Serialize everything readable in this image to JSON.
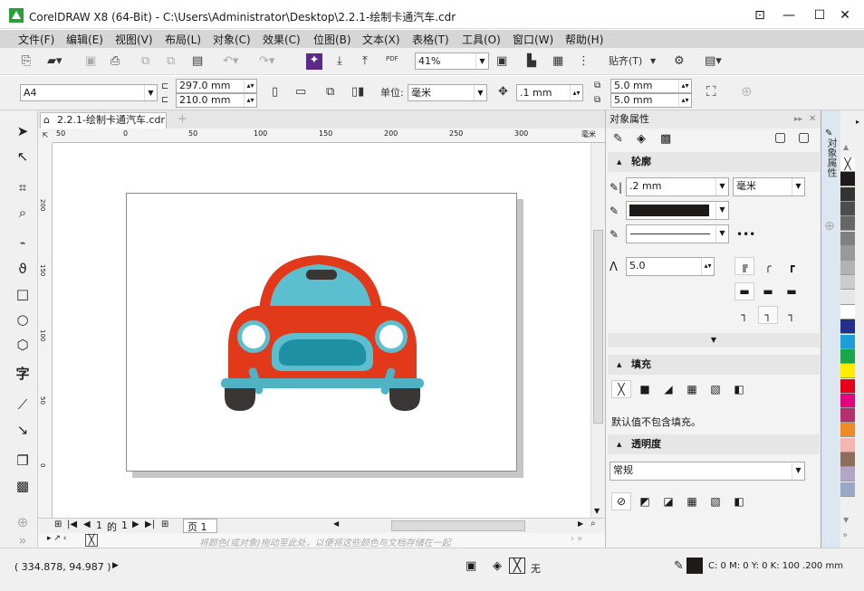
{
  "title": "CorelDRAW X8 (64-Bit) - C:\\Users\\Administrator\\Desktop\\2.2.1-绘制卡通汽车.cdr",
  "menus": [
    "文件(F)",
    "编辑(E)",
    "视图(V)",
    "布局(L)",
    "对象(C)",
    "效果(C)",
    "位图(B)",
    "文本(X)",
    "表格(T)",
    "工具(O)",
    "窗口(W)",
    "帮助(H)"
  ],
  "toolbar": {
    "zoom": "41%",
    "snap": "贴齐(T)",
    "pdf": "PDF"
  },
  "property_bar": {
    "paper": "A4",
    "width": "297.0 mm",
    "height": "210.0 mm",
    "unit_label": "单位:",
    "unit": "毫米",
    "nudge": ".1 mm",
    "dup_x": "5.0 mm",
    "dup_y": "5.0 mm"
  },
  "doc_tab": "2.2.1-绘制卡通汽车.cdr",
  "ruler": {
    "h": [
      "50",
      "0",
      "50",
      "100",
      "150",
      "200",
      "250",
      "300"
    ],
    "unit": "毫米",
    "v": [
      "200",
      "150",
      "100",
      "50",
      "0"
    ]
  },
  "page_nav": {
    "page": "1",
    "of": "的",
    "total": "1",
    "tab": "页 1"
  },
  "palette_hint": "将颜色(或对象)拖动至此处，以便将这些颜色与文档存储在一起",
  "status": {
    "coords": "( 334.878, 94.987 )",
    "fill_none": "无",
    "outline_info": "C: 0 M: 0 Y: 0 K: 100  .200 mm"
  },
  "panel": {
    "title": "对象属性",
    "vtab": "对象属性",
    "outline": {
      "header": "轮廓",
      "width": ".2 mm",
      "unit": "毫米",
      "miter": "5.0"
    },
    "fill": {
      "header": "填充",
      "note": "默认值不包含填充。"
    },
    "transparency": {
      "header": "透明度",
      "mode": "常规"
    }
  },
  "colors": {
    "car_body": "#e2391a",
    "car_window": "#5bbfcf",
    "bumper": "#4fb3c4",
    "wheel": "#3a3636",
    "accent": "#1f8fa3"
  },
  "palette": [
    "#ffffff",
    "#1e1a1a",
    "#333333",
    "#4d4d4d",
    "#666666",
    "#808080",
    "#999999",
    "#b3b3b3",
    "#cccccc",
    "#e6e6e6",
    "#ffffff",
    "#232f8c",
    "#1a9fd9",
    "#1aa64b",
    "#ffed00",
    "#e6001a",
    "#e5007e",
    "#b5306f",
    "#f08a24",
    "#f3b6b0",
    "#8c6e5a",
    "#b1a6c5",
    "#9aa7c7"
  ]
}
